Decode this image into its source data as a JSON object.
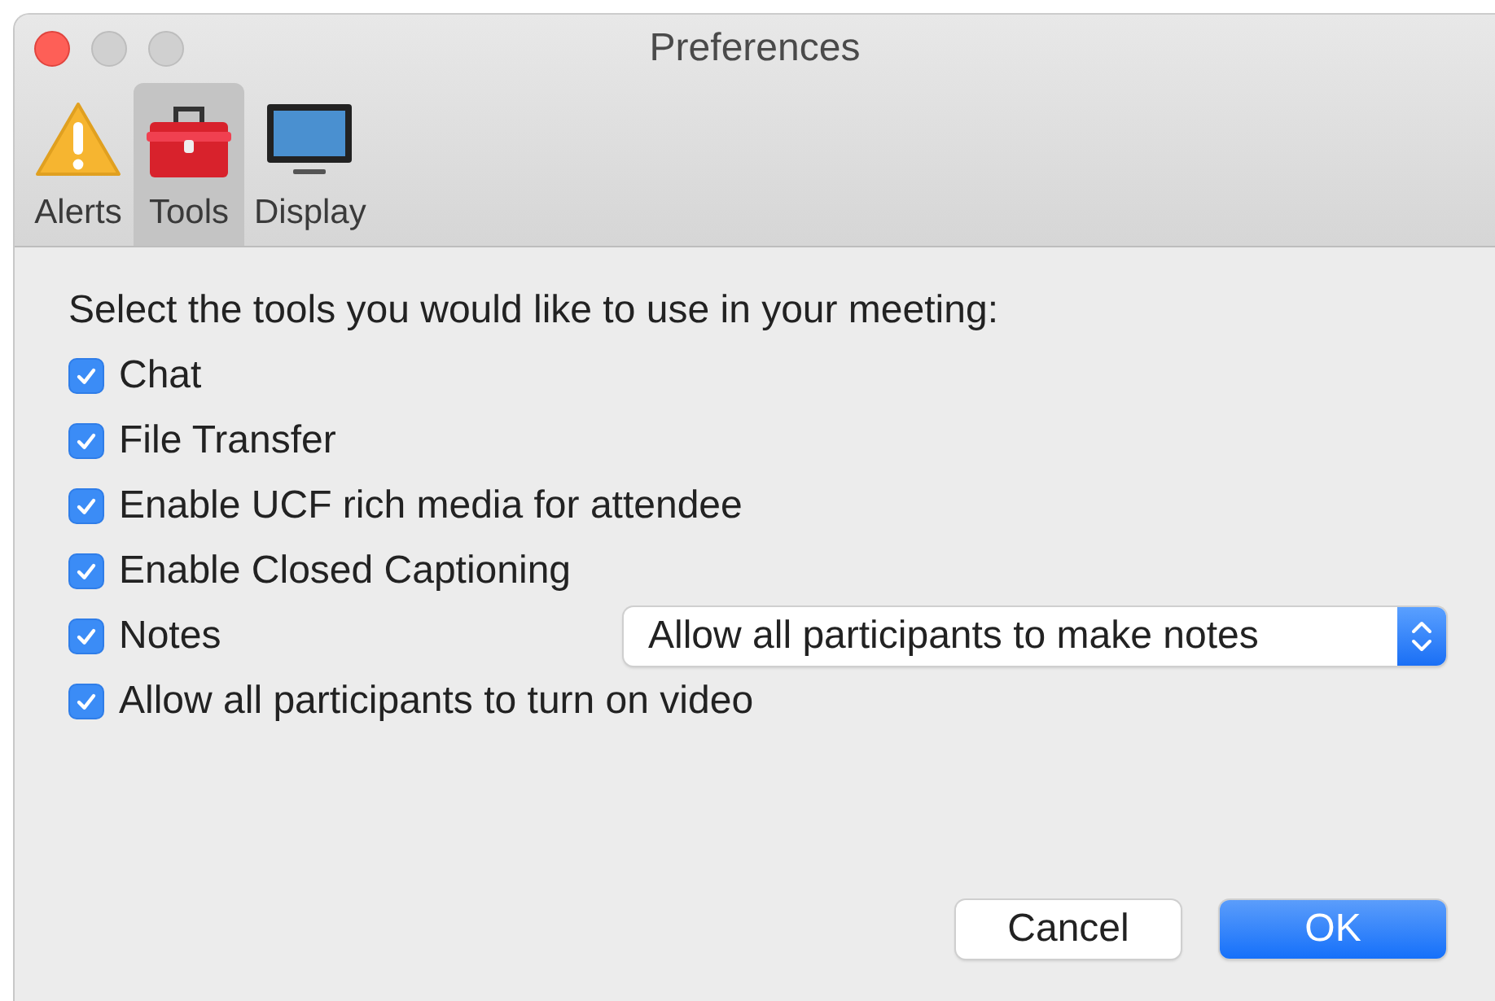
{
  "window": {
    "title": "Preferences"
  },
  "tabs": [
    {
      "label": "Alerts",
      "kind": "alert",
      "selected": false
    },
    {
      "label": "Tools",
      "kind": "toolbox",
      "selected": true
    },
    {
      "label": "Display",
      "kind": "monitor",
      "selected": false
    }
  ],
  "heading": "Select the tools you would like to use in your meeting:",
  "options": [
    {
      "label": "Chat",
      "checked": true
    },
    {
      "label": "File Transfer",
      "checked": true
    },
    {
      "label": "Enable UCF rich media for attendee",
      "checked": true
    },
    {
      "label": "Enable Closed Captioning",
      "checked": true
    },
    {
      "label": "Notes",
      "checked": true,
      "dropdown": "Allow all participants to make notes"
    },
    {
      "label": "Allow all participants to turn on video",
      "checked": true
    }
  ],
  "buttons": [
    {
      "label": "Cancel",
      "kind": "secondary"
    },
    {
      "label": "OK",
      "kind": "primary"
    }
  ]
}
